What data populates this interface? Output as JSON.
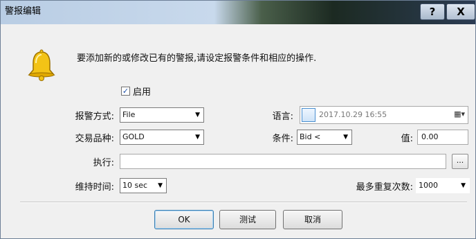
{
  "window": {
    "title": "警报编辑",
    "help_label": "?",
    "close_label": "X"
  },
  "intro_text": "要添加新的或修改已有的警报,请设定报警条件和相应的操作.",
  "enable": {
    "label": "启用",
    "checked": true,
    "check_mark": "✓"
  },
  "alarm_method": {
    "label": "报警方式:",
    "value": "File"
  },
  "symbol": {
    "label": "交易品种:",
    "value": "GOLD"
  },
  "language": {
    "label": "语言:",
    "value": "2017.10.29 16:55"
  },
  "condition": {
    "label": "条件:",
    "value": "Bid <"
  },
  "value_field": {
    "label": "值:",
    "value": "0.00"
  },
  "execute": {
    "label": "执行:",
    "value": "",
    "browse_label": "..."
  },
  "duration": {
    "label": "维持时间:",
    "value": "10 sec"
  },
  "max_repeat": {
    "label": "最多重复次数:",
    "value": "1000"
  },
  "buttons": {
    "ok": "OK",
    "test": "测试",
    "cancel": "取消"
  },
  "icons": {
    "bell": "bell-icon",
    "dropdown": "chevron-down-icon",
    "calendar": "calendar-icon"
  },
  "colors": {
    "bell_yellow": "#f3c316",
    "accent_blue": "#3c7fb1"
  }
}
